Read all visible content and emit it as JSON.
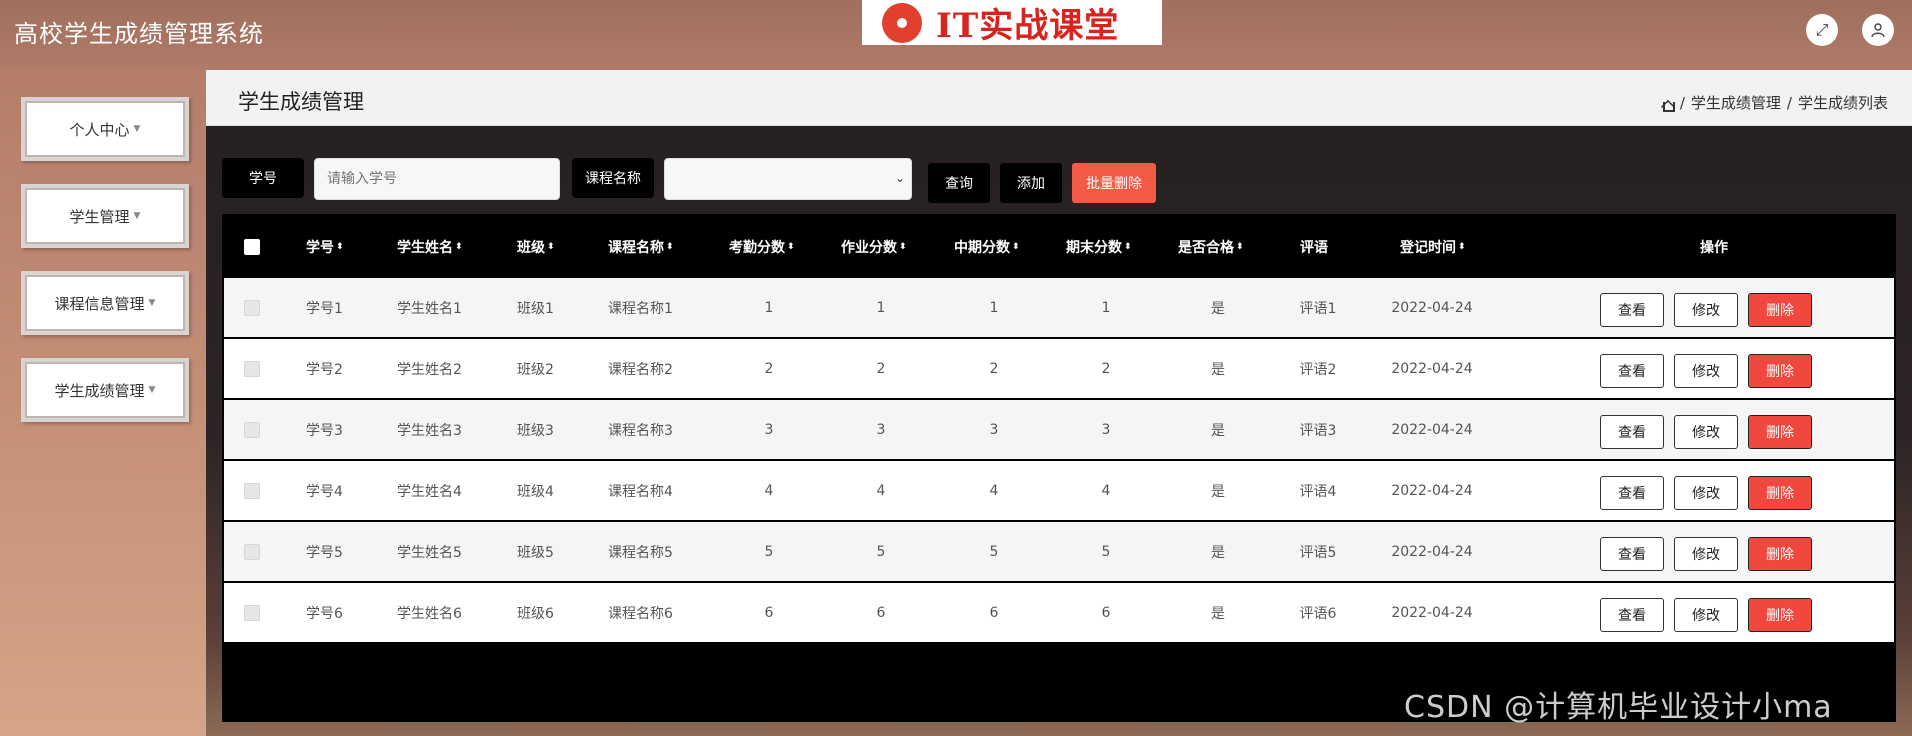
{
  "app": {
    "title": "高校学生成绩管理系统"
  },
  "logo": {
    "text": "IT实战课堂"
  },
  "header_icons": [
    "fullscreen-icon",
    "user-icon"
  ],
  "sidebar": {
    "items": [
      {
        "label": "个人中心"
      },
      {
        "label": "学生管理"
      },
      {
        "label": "课程信息管理"
      },
      {
        "label": "学生成绩管理"
      }
    ]
  },
  "page": {
    "title": "学生成绩管理",
    "breadcrumb": [
      "学生成绩管理",
      "学生成绩列表"
    ]
  },
  "search": {
    "student_no_label": "学号",
    "student_no_placeholder": "请输入学号",
    "course_label": "课程名称",
    "course_value": "",
    "query_button": "查询",
    "add_button": "添加",
    "batch_delete_button": "批量删除"
  },
  "table": {
    "headers": {
      "student_no": "学号",
      "student_name": "学生姓名",
      "class": "班级",
      "course": "课程名称",
      "attendance": "考勤分数",
      "homework": "作业分数",
      "midterm": "中期分数",
      "final": "期末分数",
      "passed": "是否合格",
      "comment": "评语",
      "reg_time": "登记时间",
      "ops": "操作"
    },
    "rows": [
      {
        "student_no": "学号1",
        "student_name": "学生姓名1",
        "class": "班级1",
        "course": "课程名称1",
        "attendance": "1",
        "homework": "1",
        "midterm": "1",
        "final": "1",
        "passed": "是",
        "comment": "评语1",
        "reg_time": "2022-04-24"
      },
      {
        "student_no": "学号2",
        "student_name": "学生姓名2",
        "class": "班级2",
        "course": "课程名称2",
        "attendance": "2",
        "homework": "2",
        "midterm": "2",
        "final": "2",
        "passed": "是",
        "comment": "评语2",
        "reg_time": "2022-04-24"
      },
      {
        "student_no": "学号3",
        "student_name": "学生姓名3",
        "class": "班级3",
        "course": "课程名称3",
        "attendance": "3",
        "homework": "3",
        "midterm": "3",
        "final": "3",
        "passed": "是",
        "comment": "评语3",
        "reg_time": "2022-04-24"
      },
      {
        "student_no": "学号4",
        "student_name": "学生姓名4",
        "class": "班级4",
        "course": "课程名称4",
        "attendance": "4",
        "homework": "4",
        "midterm": "4",
        "final": "4",
        "passed": "是",
        "comment": "评语4",
        "reg_time": "2022-04-24"
      },
      {
        "student_no": "学号5",
        "student_name": "学生姓名5",
        "class": "班级5",
        "course": "课程名称5",
        "attendance": "5",
        "homework": "5",
        "midterm": "5",
        "final": "5",
        "passed": "是",
        "comment": "评语5",
        "reg_time": "2022-04-24"
      },
      {
        "student_no": "学号6",
        "student_name": "学生姓名6",
        "class": "班级6",
        "course": "课程名称6",
        "attendance": "6",
        "homework": "6",
        "midterm": "6",
        "final": "6",
        "passed": "是",
        "comment": "评语6",
        "reg_time": "2022-04-24"
      }
    ],
    "actions": {
      "view": "查看",
      "edit": "修改",
      "delete": "删除"
    }
  },
  "watermark": "CSDN @计算机毕业设计小ma",
  "colors": {
    "delete_red": "#f0473e",
    "batch_delete": "#f25a46",
    "header_bg": "#000000"
  }
}
